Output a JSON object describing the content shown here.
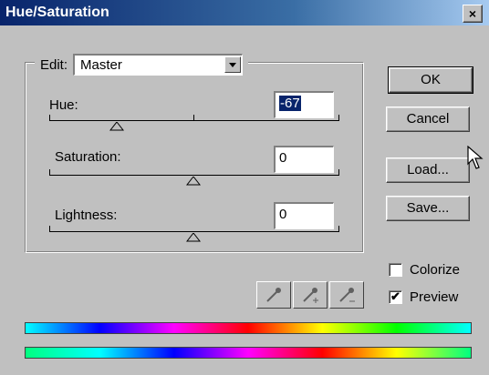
{
  "window": {
    "title": "Hue/Saturation",
    "close_label": "×"
  },
  "edit": {
    "label": "Edit:",
    "value": "Master"
  },
  "hue": {
    "label": "Hue:",
    "value": "-67"
  },
  "saturation": {
    "label": "Saturation:",
    "value": "0"
  },
  "lightness": {
    "label": "Lightness:",
    "value": "0"
  },
  "buttons": {
    "ok": "OK",
    "cancel": "Cancel",
    "load": "Load...",
    "save": "Save..."
  },
  "options": {
    "colorize": "Colorize",
    "colorize_checked": false,
    "preview": "Preview",
    "preview_checked": true
  },
  "icons": [
    "eyedropper-icon",
    "eyedropper-plus-icon",
    "eyedropper-minus-icon",
    "mouse-cursor-icon"
  ]
}
